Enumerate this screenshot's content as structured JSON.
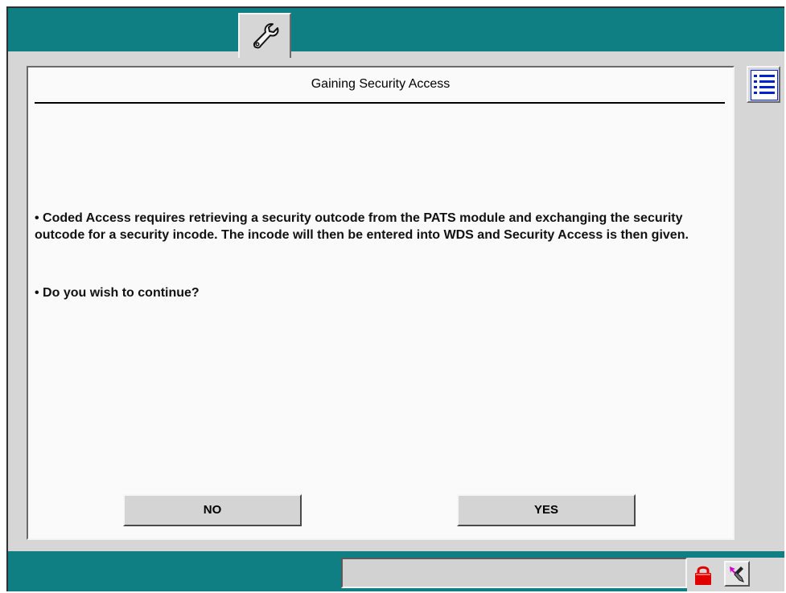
{
  "window": {
    "title": "Gaining Security Access"
  },
  "toolbar": {
    "active_tab_icon": "wrench-icon"
  },
  "message": {
    "paragraph1": "• Coded Access requires retrieving a security outcode from the PATS module and exchanging the security outcode for a security incode. The incode will then be entered into WDS and Security Access is then given.",
    "paragraph2": "• Do you wish to continue?"
  },
  "buttons": {
    "no_label": "NO",
    "yes_label": "YES"
  },
  "side_menu": {
    "icon": "list-icon"
  },
  "status_bar": {
    "text": "",
    "lock_icon": "lock-icon",
    "tool_icon": "cursor-tool-icon"
  },
  "colors": {
    "bar": "#0f7f84",
    "panel": "#fafafa",
    "chrome": "#d6d6d6",
    "list_icon": "#0022cc",
    "lock": "#e00000"
  }
}
